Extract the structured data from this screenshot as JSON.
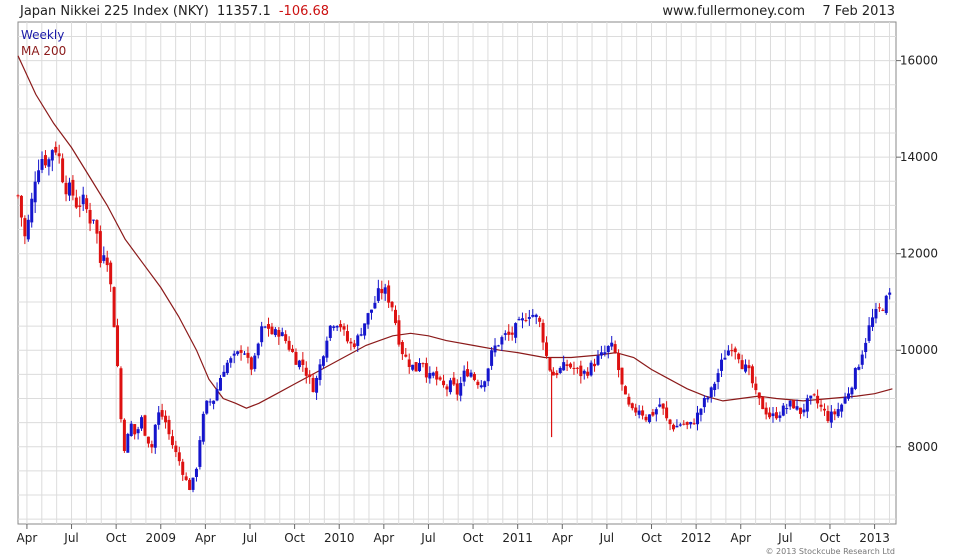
{
  "header": {
    "instrument": "Japan Nikkei 225 Index (NKY)",
    "last": "11357.1",
    "change": "-106.68",
    "site": "www.fullermoney.com",
    "date": "7 Feb 2013"
  },
  "legend": {
    "period": "Weekly",
    "ma": "MA 200",
    "period_color": "#1a1aa8",
    "ma_color": "#8b1a1a"
  },
  "credit": "© 2013 Stockcube Research Ltd",
  "colors": {
    "up": "#1515cc",
    "down": "#dd1111",
    "ma": "#8b1a1a",
    "grid": "#dcdcdc"
  },
  "chart_data": {
    "type": "candlestick",
    "ylim": [
      6400,
      16800
    ],
    "yticks": [
      8000,
      10000,
      12000,
      14000,
      16000
    ],
    "xlim": [
      2008.2,
      2013.12
    ],
    "xticks": [
      {
        "t": 2008.25,
        "label": "Apr"
      },
      {
        "t": 2008.5,
        "label": "Jul"
      },
      {
        "t": 2008.75,
        "label": "Oct"
      },
      {
        "t": 2009.0,
        "label": "2009"
      },
      {
        "t": 2009.25,
        "label": "Apr"
      },
      {
        "t": 2009.5,
        "label": "Jul"
      },
      {
        "t": 2009.75,
        "label": "Oct"
      },
      {
        "t": 2010.0,
        "label": "2010"
      },
      {
        "t": 2010.25,
        "label": "Apr"
      },
      {
        "t": 2010.5,
        "label": "Jul"
      },
      {
        "t": 2010.75,
        "label": "Oct"
      },
      {
        "t": 2011.0,
        "label": "2011"
      },
      {
        "t": 2011.25,
        "label": "Apr"
      },
      {
        "t": 2011.5,
        "label": "Jul"
      },
      {
        "t": 2011.75,
        "label": "Oct"
      },
      {
        "t": 2012.0,
        "label": "2012"
      },
      {
        "t": 2012.25,
        "label": "Apr"
      },
      {
        "t": 2012.5,
        "label": "Jul"
      },
      {
        "t": 2012.75,
        "label": "Oct"
      },
      {
        "t": 2013.0,
        "label": "2013"
      }
    ],
    "close_path": [
      [
        2008.2,
        13200
      ],
      [
        2008.24,
        12300
      ],
      [
        2008.27,
        12900
      ],
      [
        2008.3,
        13700
      ],
      [
        2008.33,
        14000
      ],
      [
        2008.37,
        13900
      ],
      [
        2008.4,
        14300
      ],
      [
        2008.43,
        14000
      ],
      [
        2008.46,
        13400
      ],
      [
        2008.5,
        13300
      ],
      [
        2008.53,
        13000
      ],
      [
        2008.57,
        13100
      ],
      [
        2008.6,
        12700
      ],
      [
        2008.63,
        12800
      ],
      [
        2008.66,
        11800
      ],
      [
        2008.69,
        12200
      ],
      [
        2008.72,
        11300
      ],
      [
        2008.75,
        10100
      ],
      [
        2008.78,
        8400
      ],
      [
        2008.8,
        7900
      ],
      [
        2008.83,
        8500
      ],
      [
        2008.86,
        8200
      ],
      [
        2008.89,
        8600
      ],
      [
        2008.92,
        8200
      ],
      [
        2008.95,
        8000
      ],
      [
        2008.98,
        8700
      ],
      [
        2009.02,
        8600
      ],
      [
        2009.05,
        8200
      ],
      [
        2009.08,
        7900
      ],
      [
        2009.11,
        7650
      ],
      [
        2009.14,
        7300
      ],
      [
        2009.17,
        7100
      ],
      [
        2009.2,
        7600
      ],
      [
        2009.23,
        8500
      ],
      [
        2009.26,
        8900
      ],
      [
        2009.3,
        9000
      ],
      [
        2009.33,
        9400
      ],
      [
        2009.36,
        9700
      ],
      [
        2009.4,
        9800
      ],
      [
        2009.43,
        9900
      ],
      [
        2009.46,
        10100
      ],
      [
        2009.5,
        9600
      ],
      [
        2009.53,
        9800
      ],
      [
        2009.56,
        10400
      ],
      [
        2009.6,
        10500
      ],
      [
        2009.63,
        10300
      ],
      [
        2009.66,
        10400
      ],
      [
        2009.7,
        10200
      ],
      [
        2009.73,
        10000
      ],
      [
        2009.76,
        9800
      ],
      [
        2009.8,
        9700
      ],
      [
        2009.83,
        9400
      ],
      [
        2009.86,
        9200
      ],
      [
        2009.9,
        9800
      ],
      [
        2009.93,
        10300
      ],
      [
        2009.96,
        10600
      ],
      [
        2010.0,
        10600
      ],
      [
        2010.03,
        10300
      ],
      [
        2010.06,
        10100
      ],
      [
        2010.1,
        10200
      ],
      [
        2010.13,
        10500
      ],
      [
        2010.16,
        10700
      ],
      [
        2010.2,
        11000
      ],
      [
        2010.23,
        11250
      ],
      [
        2010.26,
        11200
      ],
      [
        2010.3,
        10900
      ],
      [
        2010.33,
        10300
      ],
      [
        2010.36,
        9900
      ],
      [
        2010.4,
        9700
      ],
      [
        2010.43,
        9600
      ],
      [
        2010.46,
        9900
      ],
      [
        2010.5,
        9400
      ],
      [
        2010.53,
        9500
      ],
      [
        2010.56,
        9300
      ],
      [
        2010.6,
        9200
      ],
      [
        2010.63,
        9300
      ],
      [
        2010.66,
        9100
      ],
      [
        2010.7,
        9500
      ],
      [
        2010.73,
        9600
      ],
      [
        2010.76,
        9400
      ],
      [
        2010.8,
        9300
      ],
      [
        2010.83,
        9600
      ],
      [
        2010.86,
        10000
      ],
      [
        2010.9,
        10200
      ],
      [
        2010.93,
        10300
      ],
      [
        2010.96,
        10300
      ],
      [
        2011.0,
        10500
      ],
      [
        2011.03,
        10600
      ],
      [
        2011.06,
        10800
      ],
      [
        2011.1,
        10700
      ],
      [
        2011.13,
        10500
      ],
      [
        2011.17,
        9700
      ],
      [
        2011.2,
        9500
      ],
      [
        2011.24,
        9600
      ],
      [
        2011.28,
        9700
      ],
      [
        2011.32,
        9600
      ],
      [
        2011.36,
        9500
      ],
      [
        2011.4,
        9600
      ],
      [
        2011.44,
        9800
      ],
      [
        2011.48,
        9900
      ],
      [
        2011.52,
        10100
      ],
      [
        2011.55,
        9900
      ],
      [
        2011.58,
        9300
      ],
      [
        2011.61,
        8900
      ],
      [
        2011.64,
        8700
      ],
      [
        2011.68,
        8800
      ],
      [
        2011.72,
        8600
      ],
      [
        2011.76,
        8700
      ],
      [
        2011.8,
        8900
      ],
      [
        2011.84,
        8500
      ],
      [
        2011.88,
        8400
      ],
      [
        2011.92,
        8500
      ],
      [
        2011.96,
        8400
      ],
      [
        2012.0,
        8600
      ],
      [
        2012.04,
        8900
      ],
      [
        2012.08,
        9100
      ],
      [
        2012.12,
        9500
      ],
      [
        2012.16,
        9900
      ],
      [
        2012.2,
        10100
      ],
      [
        2012.23,
        10000
      ],
      [
        2012.26,
        9700
      ],
      [
        2012.3,
        9500
      ],
      [
        2012.34,
        9000
      ],
      [
        2012.38,
        8800
      ],
      [
        2012.42,
        8600
      ],
      [
        2012.46,
        8700
      ],
      [
        2012.5,
        8800
      ],
      [
        2012.54,
        8900
      ],
      [
        2012.58,
        8700
      ],
      [
        2012.62,
        8900
      ],
      [
        2012.66,
        9000
      ],
      [
        2012.7,
        8800
      ],
      [
        2012.74,
        8600
      ],
      [
        2012.78,
        8700
      ],
      [
        2012.82,
        8900
      ],
      [
        2012.86,
        9200
      ],
      [
        2012.9,
        9600
      ],
      [
        2012.94,
        10100
      ],
      [
        2012.98,
        10600
      ],
      [
        2013.02,
        10800
      ],
      [
        2013.06,
        11000
      ],
      [
        2013.1,
        11200
      ]
    ],
    "ma200": [
      [
        2008.2,
        16100
      ],
      [
        2008.3,
        15300
      ],
      [
        2008.4,
        14700
      ],
      [
        2008.5,
        14200
      ],
      [
        2008.6,
        13600
      ],
      [
        2008.7,
        13000
      ],
      [
        2008.8,
        12300
      ],
      [
        2008.9,
        11800
      ],
      [
        2009.0,
        11300
      ],
      [
        2009.1,
        10700
      ],
      [
        2009.2,
        10000
      ],
      [
        2009.27,
        9400
      ],
      [
        2009.35,
        9000
      ],
      [
        2009.42,
        8900
      ],
      [
        2009.48,
        8800
      ],
      [
        2009.55,
        8900
      ],
      [
        2009.65,
        9100
      ],
      [
        2009.75,
        9300
      ],
      [
        2009.85,
        9500
      ],
      [
        2010.0,
        9800
      ],
      [
        2010.15,
        10100
      ],
      [
        2010.3,
        10300
      ],
      [
        2010.4,
        10350
      ],
      [
        2010.5,
        10300
      ],
      [
        2010.6,
        10200
      ],
      [
        2010.75,
        10100
      ],
      [
        2010.9,
        10000
      ],
      [
        2011.0,
        9950
      ],
      [
        2011.15,
        9850
      ],
      [
        2011.3,
        9850
      ],
      [
        2011.45,
        9900
      ],
      [
        2011.55,
        9950
      ],
      [
        2011.65,
        9850
      ],
      [
        2011.75,
        9600
      ],
      [
        2011.85,
        9400
      ],
      [
        2011.95,
        9200
      ],
      [
        2012.05,
        9050
      ],
      [
        2012.15,
        8950
      ],
      [
        2012.25,
        9000
      ],
      [
        2012.35,
        9050
      ],
      [
        2012.45,
        9000
      ],
      [
        2012.6,
        8950
      ],
      [
        2012.75,
        9000
      ],
      [
        2012.9,
        9050
      ],
      [
        2013.0,
        9100
      ],
      [
        2013.1,
        9200
      ]
    ],
    "spike": {
      "t": 2011.19,
      "high": 9600,
      "low": 8200
    }
  }
}
